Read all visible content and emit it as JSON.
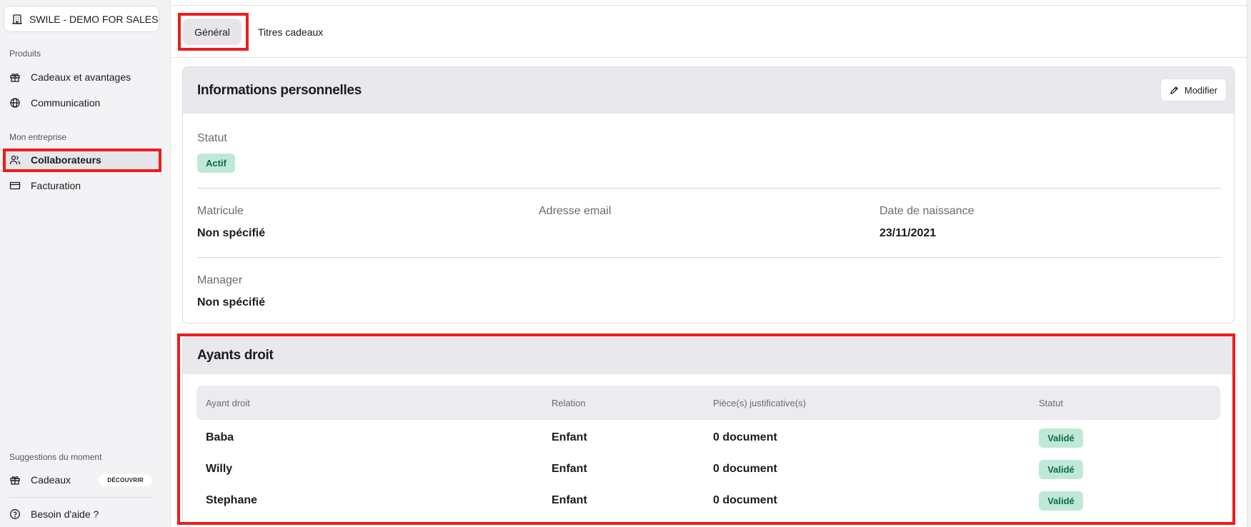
{
  "sidebar": {
    "company": "SWILE - DEMO FOR SALES",
    "sections": {
      "produits": "Produits",
      "entreprise": "Mon entreprise",
      "suggestions": "Suggestions du moment"
    },
    "items": [
      {
        "label": "Cadeaux et avantages",
        "icon": "gift-icon"
      },
      {
        "label": "Communication",
        "icon": "globe-icon"
      },
      {
        "label": "Collaborateurs",
        "icon": "users-icon",
        "active": true
      },
      {
        "label": "Facturation",
        "icon": "card-icon"
      }
    ],
    "suggestion": {
      "label": "Cadeaux",
      "badge": "DÉCOUVRIR",
      "icon": "gift-icon"
    },
    "help": {
      "label": "Besoin d'aide ?",
      "icon": "help-circle-icon"
    }
  },
  "tabs": [
    {
      "label": "Général",
      "active": true
    },
    {
      "label": "Titres cadeaux",
      "active": false
    }
  ],
  "personal": {
    "title": "Informations personnelles",
    "edit_label": "Modifier",
    "statut_label": "Statut",
    "statut_value": "Actif",
    "matricule_label": "Matricule",
    "matricule_value": "Non spécifié",
    "email_label": "Adresse email",
    "email_value": "",
    "birth_label": "Date de naissance",
    "birth_value": "23/11/2021",
    "manager_label": "Manager",
    "manager_value": "Non spécifié"
  },
  "beneficiaries": {
    "title": "Ayants droit",
    "columns": [
      "Ayant droit",
      "Relation",
      "Pièce(s) justificative(s)",
      "Statut"
    ],
    "rows": [
      {
        "name": "Baba",
        "relation": "Enfant",
        "documents": "0 document",
        "status": "Validé"
      },
      {
        "name": "Willy",
        "relation": "Enfant",
        "documents": "0 document",
        "status": "Validé"
      },
      {
        "name": "Stephane",
        "relation": "Enfant",
        "documents": "0 document",
        "status": "Validé"
      }
    ]
  },
  "colors": {
    "highlight": "#ee1c1c",
    "status_bg": "#bfe9d6",
    "status_text": "#0c6b46"
  }
}
